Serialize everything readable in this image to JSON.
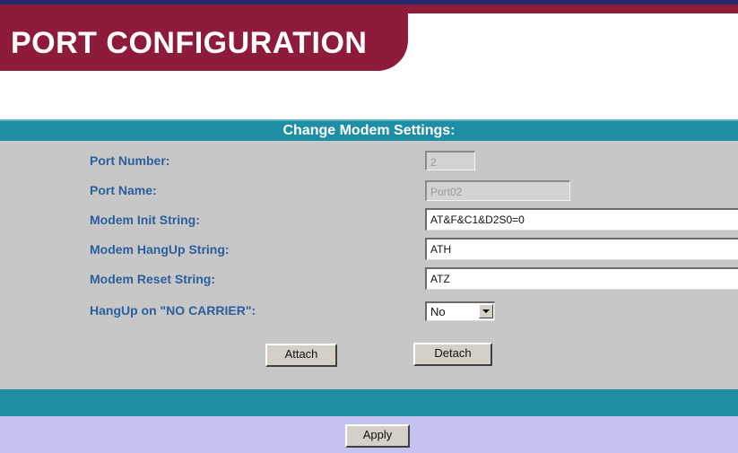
{
  "header": {
    "title": "PORT CONFIGURATION"
  },
  "section": {
    "title": "Change Modem Settings:"
  },
  "form": {
    "port_number": {
      "label": "Port Number:",
      "value": "2"
    },
    "port_name": {
      "label": "Port Name:",
      "value": "Port02"
    },
    "init_string": {
      "label": "Modem Init String:",
      "value": "AT&F&C1&D2S0=0"
    },
    "hangup_string": {
      "label": "Modem HangUp String:",
      "value": "ATH"
    },
    "reset_string": {
      "label": "Modem Reset String:",
      "value": "ATZ"
    },
    "hangup_no_carrier": {
      "label": "HangUp on \"NO CARRIER\":",
      "value": "No"
    }
  },
  "buttons": {
    "attach": "Attach",
    "detach": "Detach",
    "apply": "Apply"
  },
  "colors": {
    "header_maroon": "#8e1b3a",
    "top_rule_navy": "#232a6e",
    "section_teal": "#1d8ea3",
    "form_gray": "#c7c7c7",
    "label_blue": "#2a5f9e",
    "apply_lavender": "#c4c2ee"
  },
  "icons": {
    "select_arrow": "chevron-down-icon"
  }
}
